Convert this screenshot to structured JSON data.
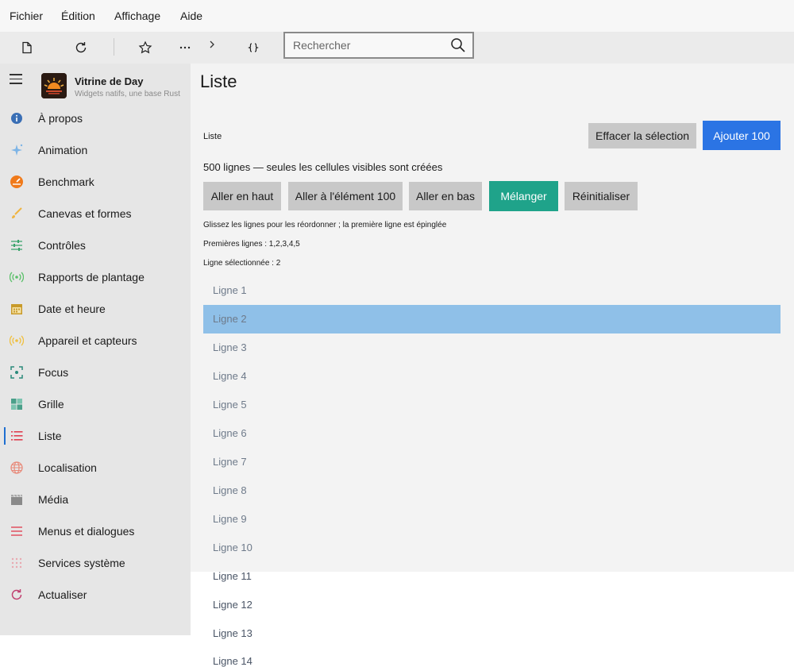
{
  "menu": {
    "file": "Fichier",
    "edit": "Édition",
    "view": "Affichage",
    "help": "Aide"
  },
  "search": {
    "placeholder": "Rechercher"
  },
  "app": {
    "title": "Vitrine de Day",
    "subtitle": "Widgets natifs, une base Rust"
  },
  "sidebar": {
    "items": [
      {
        "label": "À propos",
        "icon": "info-icon",
        "color": "#3a6fb5"
      },
      {
        "label": "Animation",
        "icon": "sparkle-icon",
        "color": "#7db4e6"
      },
      {
        "label": "Benchmark",
        "icon": "gauge-icon",
        "color": "#f07a1a"
      },
      {
        "label": "Canevas et formes",
        "icon": "brush-icon",
        "color": "#f0b440"
      },
      {
        "label": "Contrôles",
        "icon": "sliders-icon",
        "color": "#3aa36b"
      },
      {
        "label": "Rapports de plantage",
        "icon": "broadcast-icon",
        "color": "#5bc06a"
      },
      {
        "label": "Date et heure",
        "icon": "calendar-icon",
        "color": "#c89a2a"
      },
      {
        "label": "Appareil et capteurs",
        "icon": "sensor-icon",
        "color": "#f0c040"
      },
      {
        "label": "Focus",
        "icon": "focus-icon",
        "color": "#2a8a7a"
      },
      {
        "label": "Grille",
        "icon": "grid-icon",
        "color": "#4aa08a"
      },
      {
        "label": "Liste",
        "icon": "list-icon",
        "color": "#e04050"
      },
      {
        "label": "Localisation",
        "icon": "globe-icon",
        "color": "#e88a7a"
      },
      {
        "label": "Média",
        "icon": "clapper-icon",
        "color": "#8a8a8a"
      },
      {
        "label": "Menus et dialogues",
        "icon": "menu-lines-icon",
        "color": "#e05060"
      },
      {
        "label": "Services système",
        "icon": "dots-grid-icon",
        "color": "#e8a8b0"
      },
      {
        "label": "Actualiser",
        "icon": "refresh-icon",
        "color": "#c04070"
      }
    ],
    "active": "Liste"
  },
  "page": {
    "title": "Liste",
    "section_label": "Liste",
    "clear_selection": "Effacer la sélection",
    "add_100": "Ajouter 100",
    "row_count_text": "500 lignes — seules les cellules visibles sont créées",
    "actions": {
      "go_top": "Aller en haut",
      "go_item_100": "Aller à l'élément 100",
      "go_bottom": "Aller en bas",
      "shuffle": "Mélanger",
      "reset": "Réinitialiser"
    },
    "hint": "Glissez les lignes pour les réordonner ; la première ligne est épinglée",
    "first_rows": "Premières lignes : 1,2,3,4,5",
    "selected_row": "Ligne sélectionnée : 2",
    "rows": [
      "Ligne 1",
      "Ligne 2",
      "Ligne 3",
      "Ligne 4",
      "Ligne 5",
      "Ligne 6",
      "Ligne 7",
      "Ligne 8",
      "Ligne 9",
      "Ligne 10",
      "Ligne 11",
      "Ligne 12",
      "Ligne 13",
      "Ligne 14"
    ],
    "selected_index": 1
  },
  "colors": {
    "accent": "#2b74e4",
    "teal": "#1fa38a",
    "selection": "#8fc0e8",
    "active_indicator": "#1f6fd1"
  }
}
